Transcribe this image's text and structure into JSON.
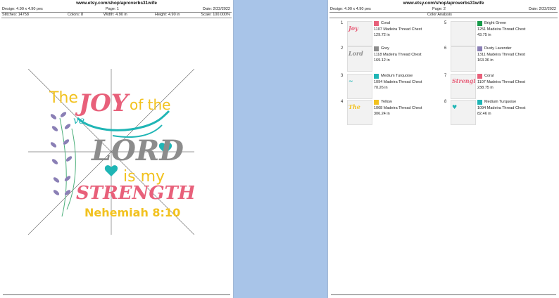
{
  "page1": {
    "url": "www.etsy.com/shop/aproverbs31wife",
    "design": "Design: 4.90 x 4.90 pes",
    "page": "Page: 1",
    "date": "Date: 2/22/2022",
    "stitches": "Stitches: 14758",
    "colors": "Colors: 8",
    "width": "Width: 4.90 in",
    "height": "Height: 4.90 in",
    "scale": "Scale: 100.000%",
    "art": {
      "the": "The",
      "joy": "JOY",
      "of_the": "of the",
      "ve": "ve",
      "lord": "LORD",
      "is_my": "is my",
      "strength": "STRENGTH",
      "verse": "Nehemiah 8:10"
    }
  },
  "page2": {
    "url": "www.etsy.com/shop/aproverbs31wife",
    "design": "Design: 4.90 x 4.90 pes",
    "page": "Page: 2",
    "date": "Date: 2/22/2022",
    "subtitle": "Color Analysis",
    "entries": [
      {
        "num": "1",
        "name": "Coral",
        "thread": "1107 Madeira Thread Chest",
        "length": "129.72 in",
        "color": "#e8607a",
        "thumb": "Joy",
        "tcolor": "#e8607a"
      },
      {
        "num": "2",
        "name": "Grey",
        "thread": "1118 Madeira Thread Chest",
        "length": "169.12 in",
        "color": "#8c8c8c",
        "thumb": "Lord",
        "tcolor": "#8c8c8c"
      },
      {
        "num": "3",
        "name": "Medium Turquoise",
        "thread": "1094 Madeira Thread Chest",
        "length": "70.26 in",
        "color": "#1fb5b5",
        "thumb": "~",
        "tcolor": "#1fb5b5"
      },
      {
        "num": "4",
        "name": "Yellow",
        "thread": "1068 Madeira Thread Chest",
        "length": "306.24 in",
        "color": "#f2c21f",
        "thumb": "The",
        "tcolor": "#f2c21f"
      },
      {
        "num": "5",
        "name": "Bright Green",
        "thread": "1251 Madeira Thread Chest",
        "length": "43.75 in",
        "color": "#179a4a",
        "thumb": "",
        "tcolor": "#179a4a"
      },
      {
        "num": "6",
        "name": "Dusty Lavender",
        "thread": "1311 Madeira Thread Chest",
        "length": "163.36 in",
        "color": "#8a7fb5",
        "thumb": "",
        "tcolor": "#8a7fb5"
      },
      {
        "num": "7",
        "name": "Coral",
        "thread": "1107 Madeira Thread Chest",
        "length": "238.75 in",
        "color": "#e8607a",
        "thumb": "Strength",
        "tcolor": "#e8607a"
      },
      {
        "num": "8",
        "name": "Medium Turquoise",
        "thread": "1094 Madeira Thread Chest",
        "length": "82.46 in",
        "color": "#1fb5b5",
        "thumb": "♥",
        "tcolor": "#1fb5b5"
      }
    ]
  }
}
